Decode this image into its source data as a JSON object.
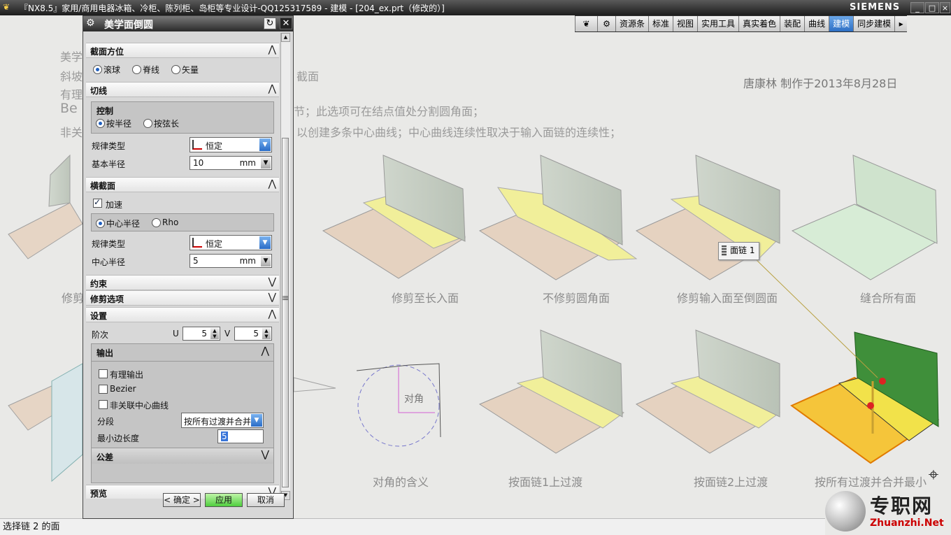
{
  "window": {
    "title": "『NX8.5』家用/商用电器冰箱、冷柜、陈列柜、岛柜等专业设计-QQ125317589 - 建模 - [204_ex.prt（修改的）]",
    "brand": "SIEMENS",
    "controls": [
      "_",
      "□",
      "×"
    ]
  },
  "ribbon_tabs": [
    "资源条",
    "标准",
    "视图",
    "实用工具",
    "真实着色",
    "装配",
    "曲线",
    "建模",
    "同步建模"
  ],
  "ribbon_active": "建模",
  "canvas": {
    "notes": [
      "美学",
      "斜坡",
      "截面",
      "有理",
      "Be",
      "节；此选项可在结点值处分割圆角面；",
      "非关",
      "以创建多条中心曲线；中心曲线连续性取决于输入面链的连续性；"
    ],
    "credit": "唐康林  制作于2013年8月28日",
    "captions_row1": [
      "修剪",
      "修剪至长入面",
      "不修剪圆角面",
      "修剪输入面至倒圆面",
      "缝合所有面"
    ],
    "captions_row2": [
      "对角的含义",
      "按面链1上过渡",
      "按面链2上过渡",
      "按所有过渡并合并最小"
    ],
    "diagonal_label": "对角",
    "face_chain_tag": "面链 1"
  },
  "status_bar": {
    "text": "选择链 2 的面"
  },
  "watermark": {
    "cn": "专职网",
    "en": "Zhuanzhi.Net"
  },
  "colors": {
    "accent": "#2d6fc4",
    "apply": "#4fcf3e",
    "surface_yellow": "#f2f08a",
    "surface_green": "#3f8f3a"
  },
  "dialog": {
    "title": "美学面倒圆",
    "sections": {
      "section_orientation": {
        "label": "截面方位",
        "options": [
          "滚球",
          "脊线",
          "矢量"
        ],
        "selected": "滚球"
      },
      "tangent": {
        "label": "切线",
        "control_group": "控制",
        "control_options": [
          "按半径",
          "按弦长"
        ],
        "control_selected": "按半径",
        "law_type_label": "规律类型",
        "law_type_value": "恒定",
        "base_radius_label": "基本半径",
        "base_radius_value": "10",
        "base_radius_unit": "mm"
      },
      "cross_section": {
        "label": "横截面",
        "accelerate_label": "加速",
        "accelerate_checked": true,
        "options": [
          "中心半径",
          "Rho"
        ],
        "selected": "中心半径",
        "law_type_label": "规律类型",
        "law_type_value": "恒定",
        "center_radius_label": "中心半径",
        "center_radius_value": "5",
        "center_radius_unit": "mm"
      },
      "constraints": {
        "label": "约束"
      },
      "trim_options": {
        "label": "修剪选项"
      },
      "settings": {
        "label": "设置",
        "degree_label": "阶次",
        "u_label": "U",
        "u_value": "5",
        "v_label": "V",
        "v_value": "5",
        "output_group": "输出",
        "rational_label": "有理输出",
        "bezier_label": "Bezier",
        "assoc_label": "非关联中心曲线",
        "segment_label": "分段",
        "segment_value": "按所有过渡并合并",
        "min_edge_label": "最小边长度",
        "min_edge_value": "5",
        "tolerance_label": "公差"
      },
      "preview": {
        "label": "预览"
      }
    },
    "buttons": {
      "ok": "< 确定 >",
      "apply": "应用",
      "cancel": "取消"
    }
  }
}
